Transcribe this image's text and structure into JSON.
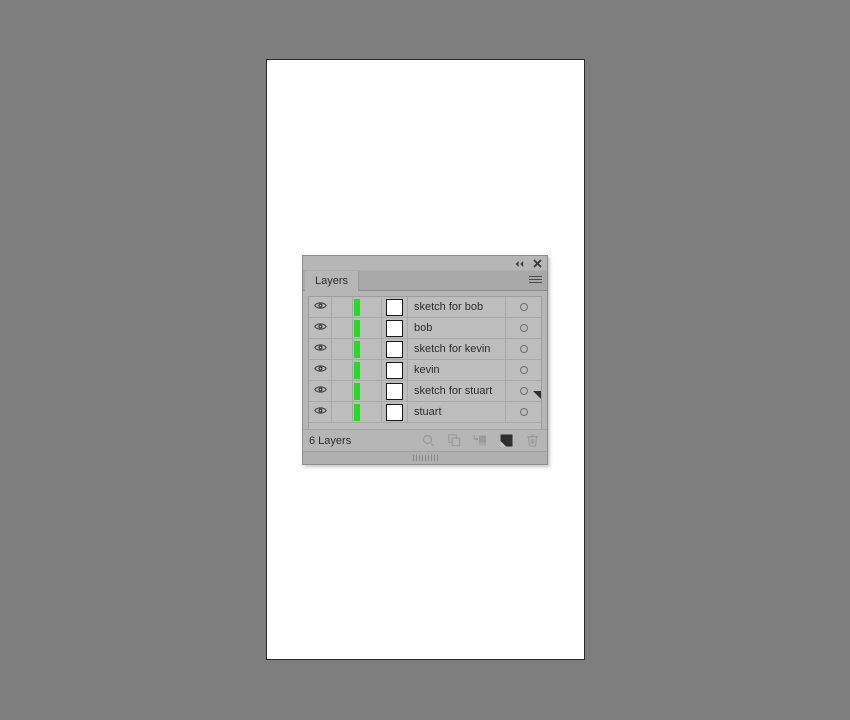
{
  "panel": {
    "titlebar": {
      "collapse_label": "◂◂",
      "close_label": "✕"
    },
    "tab_label": "Layers",
    "menu_icon": "panel-menu-icon",
    "footer": {
      "count_label": "6 Layers",
      "buttons": [
        {
          "name": "locate-object-button",
          "icon": "magnifier-icon"
        },
        {
          "name": "make-clipping-mask-button",
          "icon": "clipping-mask-icon"
        },
        {
          "name": "create-new-sublayer-button",
          "icon": "new-sublayer-icon"
        },
        {
          "name": "create-new-layer-button",
          "icon": "new-layer-icon"
        },
        {
          "name": "delete-selection-button",
          "icon": "trash-icon"
        }
      ]
    },
    "layers": [
      {
        "name": "sketch for bob",
        "color": "#22dd22",
        "visible": true,
        "locked": false,
        "selected": false
      },
      {
        "name": "bob",
        "color": "#22dd22",
        "visible": true,
        "locked": false,
        "selected": false
      },
      {
        "name": "sketch for kevin",
        "color": "#22dd22",
        "visible": true,
        "locked": false,
        "selected": false
      },
      {
        "name": "kevin",
        "color": "#22dd22",
        "visible": true,
        "locked": false,
        "selected": false
      },
      {
        "name": "sketch for stuart",
        "color": "#22dd22",
        "visible": true,
        "locked": false,
        "selected": false
      },
      {
        "name": "stuart",
        "color": "#22dd22",
        "visible": true,
        "locked": false,
        "selected": false
      }
    ]
  },
  "colors": {
    "workspace_background": "#7e7e7e",
    "page_background": "#ffffff",
    "panel_background": "#b6b6b6",
    "list_background": "#bdbdbd",
    "layer_color_swatch": "#22dd22",
    "text": "#2c2c2c"
  }
}
